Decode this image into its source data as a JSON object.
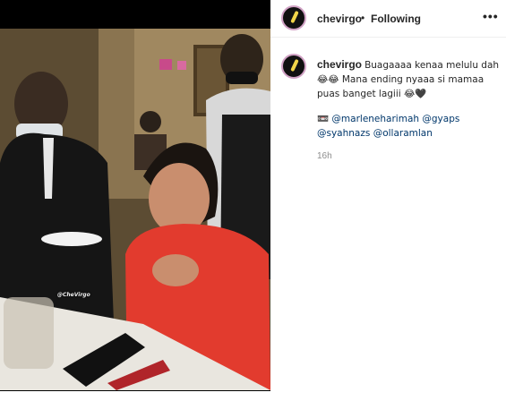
{
  "post": {
    "username": "chevirgo",
    "separator": "•",
    "follow_status": "Following",
    "more_icon": "•••"
  },
  "video": {
    "watermark": "@CheVirgo"
  },
  "comment": {
    "username": "chevirgo",
    "text_line1": "Buagaaaa kenaa melulu dah",
    "text_line2": "😂😂 Mana ending nyaaa si mamaa",
    "text_line3": "puas banget lagiii 😂🖤",
    "tag_prefix": "📼",
    "tags": [
      "@marleneharimah",
      "@gyaps",
      "@syahnazs",
      "@ollaramlan"
    ],
    "time": "16h"
  }
}
